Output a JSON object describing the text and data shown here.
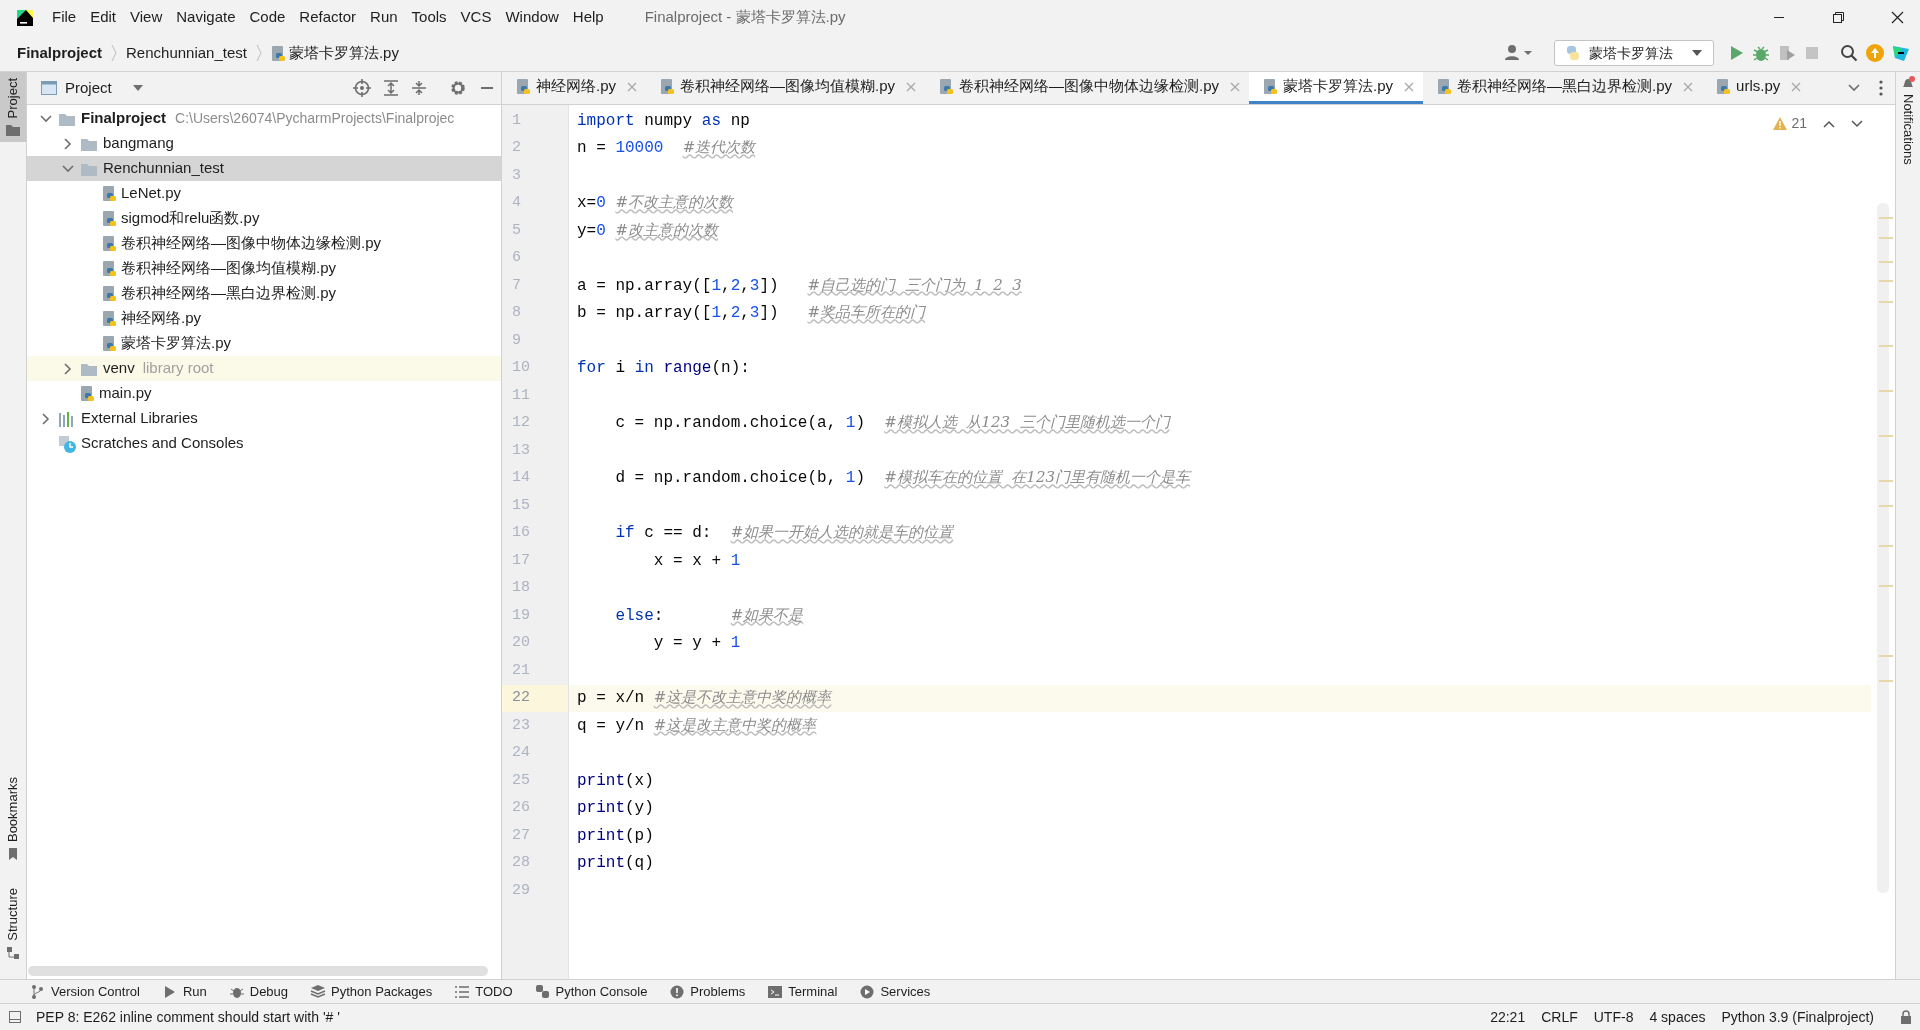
{
  "window": {
    "title": "Finalproject - 蒙塔卡罗算法.py"
  },
  "menu": [
    "File",
    "Edit",
    "View",
    "Navigate",
    "Code",
    "Refactor",
    "Run",
    "Tools",
    "VCS",
    "Window",
    "Help"
  ],
  "breadcrumbs": [
    {
      "label": "Finalproject",
      "kind": "project"
    },
    {
      "label": "Renchunnian_test",
      "kind": "folder"
    },
    {
      "label": "蒙塔卡罗算法.py",
      "kind": "file"
    }
  ],
  "toolbar": {
    "run_configuration": "蒙塔卡罗算法"
  },
  "left_stripe": {
    "top": [
      {
        "label": "Project",
        "selected": true
      }
    ],
    "bottom": [
      {
        "label": "Bookmarks",
        "selected": false
      },
      {
        "label": "Structure",
        "selected": false
      }
    ]
  },
  "project_panel": {
    "title": "Project",
    "tree": [
      {
        "label": "Finalproject",
        "kind": "project",
        "path": "C:\\Users\\26074\\PycharmProjects\\Finalprojec",
        "expanded": true,
        "selected": false,
        "children": [
          {
            "label": "bangmang",
            "kind": "folder",
            "expanded": false,
            "selected": false
          },
          {
            "label": "Renchunnian_test",
            "kind": "folder",
            "expanded": true,
            "selected": true,
            "children": [
              {
                "label": "LeNet.py",
                "kind": "file",
                "selected": false
              },
              {
                "label": "sigmod和relu函数.py",
                "kind": "file",
                "selected": false
              },
              {
                "label": "卷积神经网络—图像中物体边缘检测.py",
                "kind": "file",
                "selected": false
              },
              {
                "label": "卷积神经网络—图像均值模糊.py",
                "kind": "file",
                "selected": false
              },
              {
                "label": "卷积神经网络—黑白边界检测.py",
                "kind": "file",
                "selected": false
              },
              {
                "label": "神经网络.py",
                "kind": "file",
                "selected": false
              },
              {
                "label": "蒙塔卡罗算法.py",
                "kind": "file",
                "selected": false
              }
            ]
          },
          {
            "label": "venv",
            "kind": "library_root",
            "hint": "library root",
            "expanded": false,
            "selected": false
          },
          {
            "label": "main.py",
            "kind": "file",
            "selected": false
          }
        ]
      },
      {
        "label": "External Libraries",
        "kind": "libraries",
        "expanded": false,
        "selected": false
      },
      {
        "label": "Scratches and Consoles",
        "kind": "scratches",
        "selected": false
      }
    ]
  },
  "tabs": [
    {
      "label": "神经网络.py",
      "selected": false
    },
    {
      "label": "卷积神经网络—图像均值模糊.py",
      "selected": false
    },
    {
      "label": "卷积神经网络—图像中物体边缘检测.py",
      "selected": false
    },
    {
      "label": "蒙塔卡罗算法.py",
      "selected": true
    },
    {
      "label": "卷积神经网络—黑白边界检测.py",
      "selected": false
    },
    {
      "label": "urls.py",
      "selected": false
    }
  ],
  "editor": {
    "warnings": "21",
    "lines": [
      {
        "number": "1",
        "current": false,
        "tokens": [
          {
            "kind": "keyword",
            "text": "import"
          },
          {
            "kind": "plain",
            "text": " numpy "
          },
          {
            "kind": "keyword",
            "text": "as"
          },
          {
            "kind": "plain",
            "text": " np"
          }
        ]
      },
      {
        "number": "2",
        "current": false,
        "tokens": [
          {
            "kind": "plain",
            "text": "n = "
          },
          {
            "kind": "number",
            "text": "10000  "
          },
          {
            "kind": "comment",
            "text": "#迭代次数"
          }
        ]
      },
      {
        "number": "3",
        "current": false
      },
      {
        "number": "4",
        "current": false,
        "tokens": [
          {
            "kind": "plain",
            "text": "x="
          },
          {
            "kind": "number",
            "text": "0 "
          },
          {
            "kind": "comment",
            "text": "#不改主意的次数"
          }
        ]
      },
      {
        "number": "5",
        "current": false,
        "tokens": [
          {
            "kind": "plain",
            "text": "y="
          },
          {
            "kind": "number",
            "text": "0 "
          },
          {
            "kind": "comment",
            "text": "#改主意的次数"
          }
        ]
      },
      {
        "number": "6",
        "current": false
      },
      {
        "number": "7",
        "current": false,
        "tokens": [
          {
            "kind": "plain",
            "text": "a = np.array(["
          },
          {
            "kind": "number",
            "text": "1"
          },
          {
            "kind": "plain",
            "text": ","
          },
          {
            "kind": "number",
            "text": "2"
          },
          {
            "kind": "plain",
            "text": ","
          },
          {
            "kind": "number",
            "text": "3"
          },
          {
            "kind": "plain",
            "text": "])   "
          },
          {
            "kind": "comment",
            "text": "#自己选的门  三个门为  1  2  3"
          }
        ]
      },
      {
        "number": "8",
        "current": false,
        "tokens": [
          {
            "kind": "plain",
            "text": "b = np.array(["
          },
          {
            "kind": "number",
            "text": "1"
          },
          {
            "kind": "plain",
            "text": ","
          },
          {
            "kind": "number",
            "text": "2"
          },
          {
            "kind": "plain",
            "text": ","
          },
          {
            "kind": "number",
            "text": "3"
          },
          {
            "kind": "plain",
            "text": "])   "
          },
          {
            "kind": "comment",
            "text": "#奖品车所在的门"
          }
        ]
      },
      {
        "number": "9",
        "current": false
      },
      {
        "number": "10",
        "current": false,
        "tokens": [
          {
            "kind": "keyword",
            "text": "for"
          },
          {
            "kind": "plain",
            "text": " i "
          },
          {
            "kind": "keyword",
            "text": "in "
          },
          {
            "kind": "builtin",
            "text": "range"
          },
          {
            "kind": "plain",
            "text": "(n):"
          }
        ]
      },
      {
        "number": "11",
        "current": false
      },
      {
        "number": "12",
        "current": false,
        "tokens": [
          {
            "kind": "plain",
            "text": "    c = np.random.choice(a, "
          },
          {
            "kind": "number",
            "text": "1"
          },
          {
            "kind": "plain",
            "text": ")  "
          },
          {
            "kind": "comment",
            "text": "#模拟人选  从123  三个门里随机选一个门"
          }
        ]
      },
      {
        "number": "13",
        "current": false
      },
      {
        "number": "14",
        "current": false,
        "tokens": [
          {
            "kind": "plain",
            "text": "    d = np.random.choice(b, "
          },
          {
            "kind": "number",
            "text": "1"
          },
          {
            "kind": "plain",
            "text": ")  "
          },
          {
            "kind": "comment",
            "text": "#模拟车在的位置  在123门里有随机一个是车"
          }
        ]
      },
      {
        "number": "15",
        "current": false
      },
      {
        "number": "16",
        "current": false,
        "tokens": [
          {
            "kind": "keyword",
            "text": "    if"
          },
          {
            "kind": "plain",
            "text": " c == d:  "
          },
          {
            "kind": "comment",
            "text": "#如果一开始人选的就是车的位置"
          }
        ]
      },
      {
        "number": "17",
        "current": false,
        "tokens": [
          {
            "kind": "plain",
            "text": "        x = x + "
          },
          {
            "kind": "number",
            "text": "1"
          }
        ]
      },
      {
        "number": "18",
        "current": false
      },
      {
        "number": "19",
        "current": false,
        "tokens": [
          {
            "kind": "keyword",
            "text": "    else"
          },
          {
            "kind": "plain",
            "text": ":       "
          },
          {
            "kind": "comment",
            "text": "#如果不是"
          }
        ]
      },
      {
        "number": "20",
        "current": false,
        "tokens": [
          {
            "kind": "plain",
            "text": "        y = y + "
          },
          {
            "kind": "number",
            "text": "1"
          }
        ]
      },
      {
        "number": "21",
        "current": false
      },
      {
        "number": "22",
        "current": true,
        "tokens": [
          {
            "kind": "plain",
            "text": "p = x/n "
          },
          {
            "kind": "comment",
            "text": "#这是不改主意中奖的概率"
          }
        ]
      },
      {
        "number": "23",
        "current": false,
        "tokens": [
          {
            "kind": "plain",
            "text": "q = y/n "
          },
          {
            "kind": "comment",
            "text": "#这是改主意中奖的概率"
          }
        ]
      },
      {
        "number": "24",
        "current": false
      },
      {
        "number": "25",
        "current": false,
        "tokens": [
          {
            "kind": "builtin",
            "text": "print"
          },
          {
            "kind": "plain",
            "text": "(x)"
          }
        ]
      },
      {
        "number": "26",
        "current": false,
        "tokens": [
          {
            "kind": "builtin",
            "text": "print"
          },
          {
            "kind": "plain",
            "text": "(y)"
          }
        ]
      },
      {
        "number": "27",
        "current": false,
        "tokens": [
          {
            "kind": "builtin",
            "text": "print"
          },
          {
            "kind": "plain",
            "text": "(p)"
          }
        ]
      },
      {
        "number": "28",
        "current": false,
        "tokens": [
          {
            "kind": "builtin",
            "text": "print"
          },
          {
            "kind": "plain",
            "text": "(q)"
          }
        ]
      },
      {
        "number": "29",
        "current": false
      }
    ]
  },
  "right_stripe": [
    "Notifications"
  ],
  "tool_windows": [
    {
      "label": "Version Control",
      "kind": "vcs"
    },
    {
      "label": "Run",
      "kind": "run"
    },
    {
      "label": "Debug",
      "kind": "debug"
    },
    {
      "label": "Python Packages",
      "kind": "packages"
    },
    {
      "label": "TODO",
      "kind": "todo"
    },
    {
      "label": "Python Console",
      "kind": "console"
    },
    {
      "label": "Problems",
      "kind": "problems"
    },
    {
      "label": "Terminal",
      "kind": "terminal"
    },
    {
      "label": "Services",
      "kind": "services"
    }
  ],
  "status_bar": {
    "message": "PEP 8: E262 inline comment should start with '# '",
    "items": [
      "22:21",
      "CRLF",
      "UTF-8",
      "4 spaces",
      "Python 3.9 (Finalproject)"
    ]
  }
}
